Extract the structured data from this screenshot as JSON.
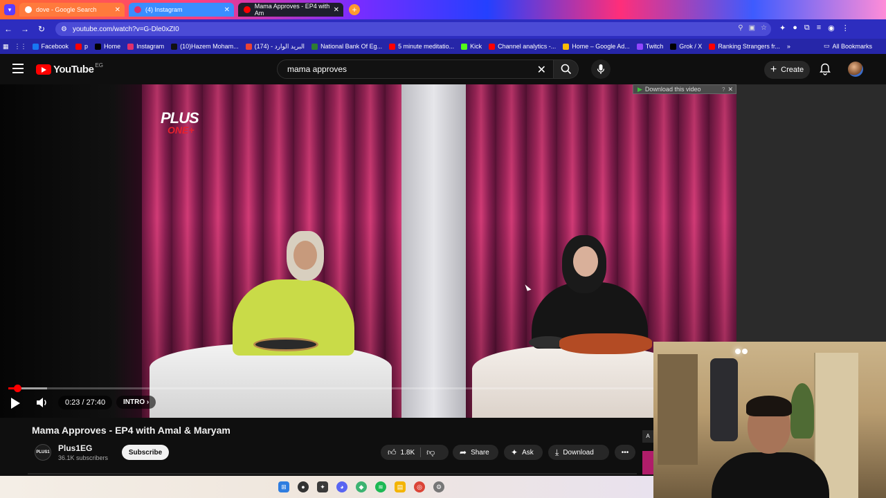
{
  "browser": {
    "tabs": [
      {
        "title": "dove - Google Search",
        "favicon_color": "#ffffff"
      },
      {
        "title": "(4) Instagram",
        "favicon_color": "#e1306c"
      },
      {
        "title": "Mama Approves - EP4 with Am",
        "favicon_color": "#ff0000"
      }
    ],
    "url": "youtube.com/watch?v=G-Dle0xZI0",
    "bookmarks": [
      {
        "label": "Facebook",
        "color": "#1877f2"
      },
      {
        "label": "p",
        "color": "#ff0000"
      },
      {
        "label": "Home",
        "color": "#000000"
      },
      {
        "label": "Instagram",
        "color": "#e1306c"
      },
      {
        "label": "(10)Hazem Moham...",
        "color": "#111111"
      },
      {
        "label": "(174) - البريد الوارد",
        "color": "#ea4335"
      },
      {
        "label": "National Bank Of Eg...",
        "color": "#2e7d32"
      },
      {
        "label": "5 minute meditatio...",
        "color": "#ff0000"
      },
      {
        "label": "Kick",
        "color": "#53fc18"
      },
      {
        "label": "Channel analytics -...",
        "color": "#ff0000"
      },
      {
        "label": "Home – Google Ad...",
        "color": "#fbbc04"
      },
      {
        "label": "Twitch",
        "color": "#9146ff"
      },
      {
        "label": "Grok / X",
        "color": "#000000"
      },
      {
        "label": "Ranking Strangers fr...",
        "color": "#ff0000"
      }
    ],
    "all_bookmarks": "All Bookmarks"
  },
  "youtube": {
    "logo_text": "YouTube",
    "country_code": "EG",
    "search_query": "mama approves",
    "create_label": "Create"
  },
  "player": {
    "brand_line1": "PLUS",
    "brand_line2": "ONE+",
    "download_overlay": "Download this video",
    "download_overlay_help": "?",
    "time": "0:23 / 27:40",
    "chapter": "INTRO",
    "progress_fraction": 0.0139
  },
  "video": {
    "title": "Mama Approves - EP4 with Amal & Maryam",
    "channel_avatar_text": "PLUS1",
    "channel_name": "Plus1EG",
    "subscribers": "36.1K subscribers",
    "subscribe_label": "Subscribe",
    "likes": "1.8K",
    "share_label": "Share",
    "ask_label": "Ask",
    "download_label": "Download",
    "more_label": "•••",
    "side_tag": "A"
  },
  "colors": {
    "accent_red": "#ff0000"
  }
}
